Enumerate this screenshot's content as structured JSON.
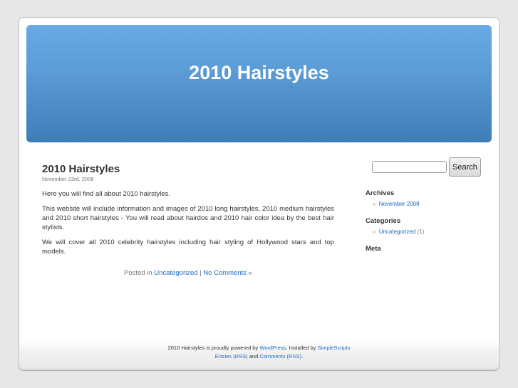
{
  "header": {
    "site_title": "2010 Hairstyles"
  },
  "post": {
    "title": "2010 Hairstyles",
    "date": "November 23rd, 2008",
    "paragraphs": [
      "Here you will find all about 2010 hairstyles.",
      "This website will include information and images of 2010 long hairstyles, 2010 medium hairstyles and 2010 short hairstyles - You will read about hairdos and 2010 hair color idea by the best hair stylists.",
      "We will cover all 2010 celebrity hairstyles including hair styling of Hollywood stars and top models."
    ],
    "meta": {
      "posted_in": "Posted in",
      "category_link": "Uncategorized",
      "separator": "|",
      "comments_link": "No Comments »"
    }
  },
  "sidebar": {
    "search": {
      "value": "",
      "placeholder": "",
      "button_label": "Search"
    },
    "archives": {
      "title": "Archives",
      "items": [
        {
          "bullet": "»",
          "label": "November 2008"
        }
      ]
    },
    "categories": {
      "title": "Categories",
      "items": [
        {
          "bullet": "»",
          "label": "Uncategorized",
          "count": "(1)"
        }
      ]
    },
    "meta": {
      "title": "Meta"
    }
  },
  "footer": {
    "line1_prefix": "2010 Hairstyles is proudly powered by",
    "wordpress_link": "WordPress",
    "line1_mid": ". Installed by",
    "simplescripts_link": "SimpleScripts",
    "entries_link": "Entries (RSS)",
    "and_text": "and",
    "comments_link": "Comments (RSS)",
    "end": "."
  },
  "colors": {
    "link": "#1e6bc7",
    "header_top": "#69aae5",
    "header_bottom": "#3f7db6",
    "background": "#e7e7e7"
  }
}
